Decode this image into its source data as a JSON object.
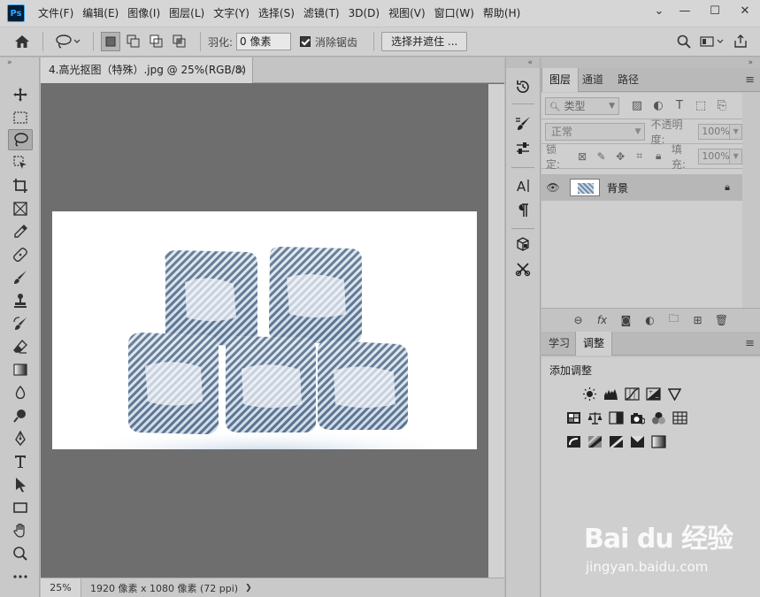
{
  "app": {
    "logo": "Ps"
  },
  "menu": [
    "文件(F)",
    "编辑(E)",
    "图像(I)",
    "图层(L)",
    "文字(Y)",
    "选择(S)",
    "滤镜(T)",
    "3D(D)",
    "视图(V)",
    "窗口(W)",
    "帮助(H)"
  ],
  "window_controls": {
    "collapse": "⌄",
    "minimize": "—",
    "maximize": "☐",
    "close": "✕"
  },
  "options": {
    "feather_label": "羽化:",
    "feather_value": "0 像素",
    "antialias_label": "消除锯齿",
    "select_mask_label": "选择并遮住 ..."
  },
  "document": {
    "tab_title": "4.高光抠图（特殊）.jpg @ 25%(RGB/8)",
    "tab_close": "×",
    "zoom": "25%",
    "info": "1920 像素 x 1080 像素 (72 ppi)",
    "info_arrow": "❯"
  },
  "layers_panel": {
    "tabs": [
      "图层",
      "通道",
      "路径"
    ],
    "kind_placeholder": "类型",
    "blend_mode": "正常",
    "opacity_label": "不透明度:",
    "opacity_value": "100%",
    "lock_label": "锁定:",
    "fill_label": "填充:",
    "fill_value": "100%",
    "layer_name": "背景"
  },
  "adjust_panel": {
    "tabs": [
      "学习",
      "调整"
    ],
    "title": "添加调整"
  },
  "watermark": {
    "brand": "Bai du 经验",
    "url": "jingyan.baidu.com"
  },
  "colors": {
    "menubar": "#d6d6d6",
    "canvas_bg": "#6e6e6e",
    "panel": "#cfcfcf",
    "ice": "#4a6a8f"
  }
}
